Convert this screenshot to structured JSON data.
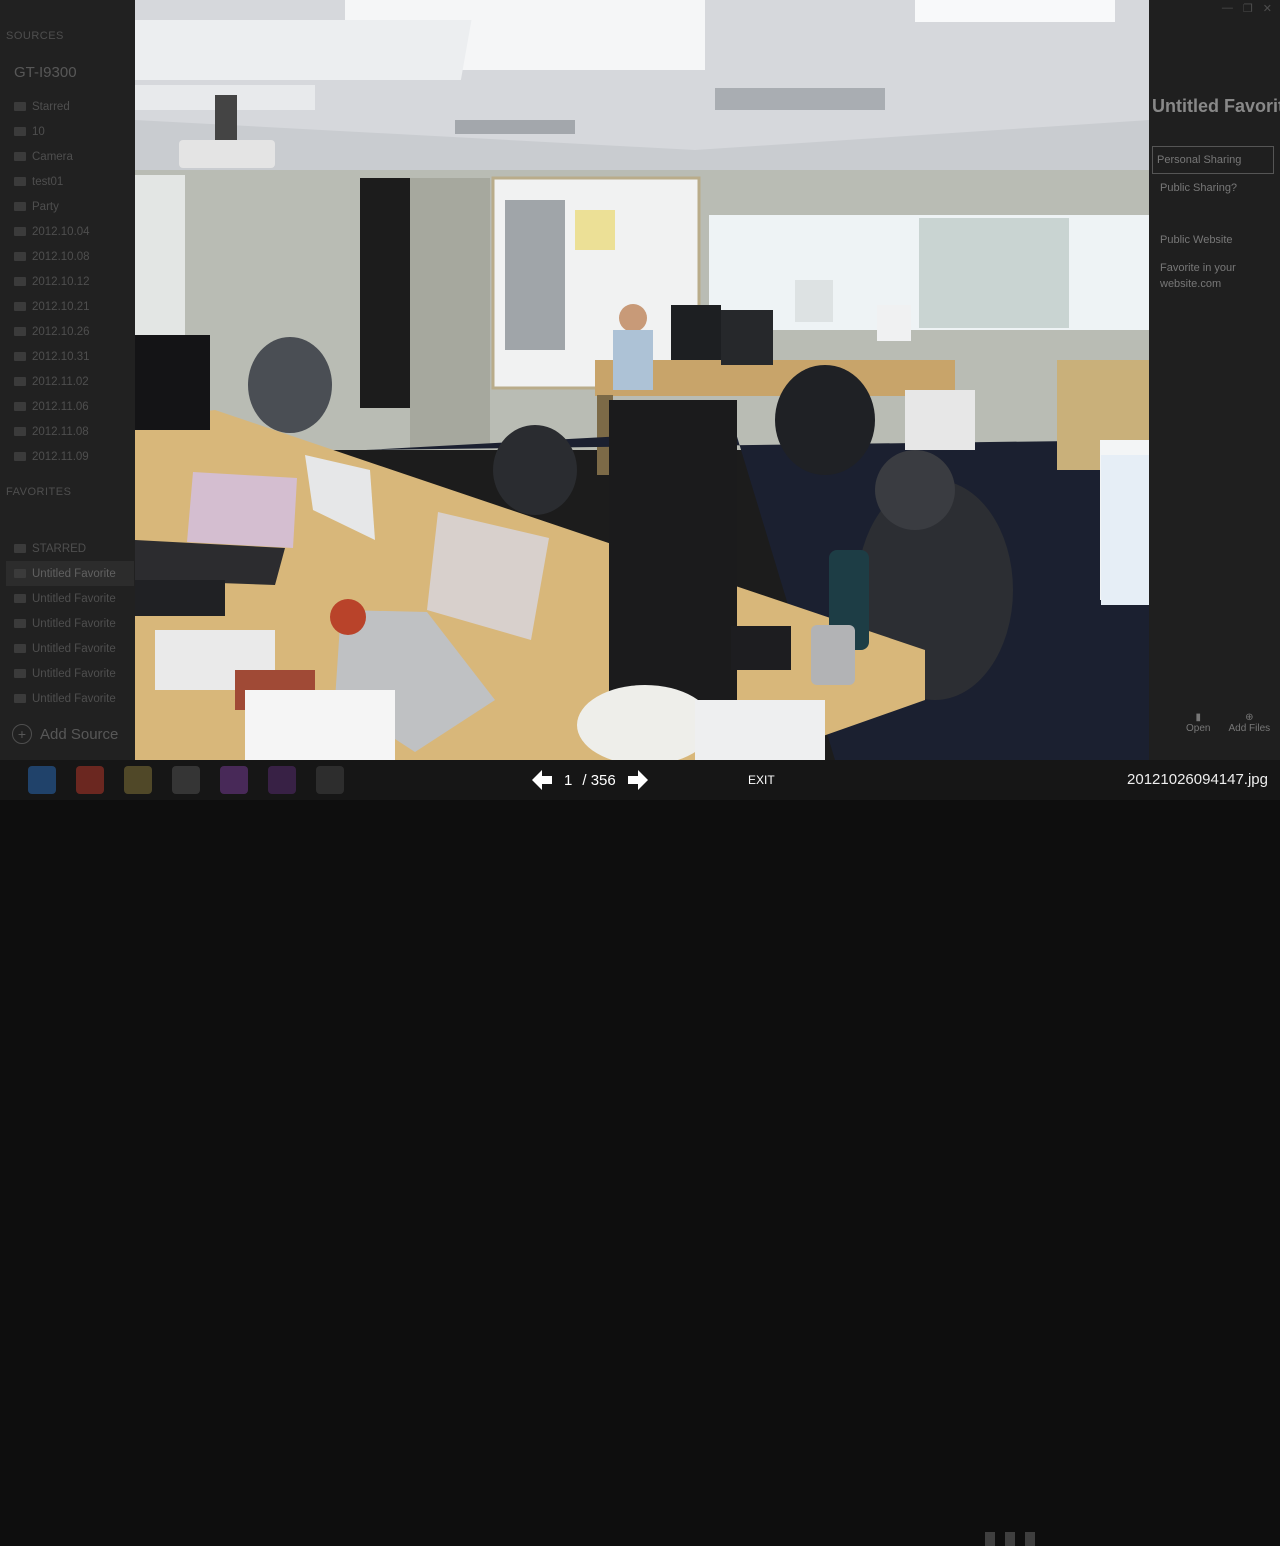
{
  "background_app": {
    "sources_header": "SOURCES",
    "device_name": "GT-I9300",
    "source_items": [
      "Starred",
      "10",
      "Camera",
      "test01",
      "Party",
      "2012.10.04",
      "2012.10.08",
      "2012.10.12",
      "2012.10.21",
      "2012.10.26",
      "2012.10.31",
      "2012.11.02",
      "2012.11.06",
      "2012.11.08",
      "2012.11.09"
    ],
    "favorites_header": "FAVORITES",
    "favorite_items": [
      "STARRED",
      "Untitled Favorite",
      "Untitled Favorite",
      "Untitled Favorite",
      "Untitled Favorite",
      "Untitled Favorite",
      "Untitled Favorite"
    ],
    "add_source_label": "Add Source",
    "right_panel_title": "Untitled Favorite",
    "right_panel_box": "Personal Sharing",
    "right_panel_lines": [
      "Public Sharing?",
      "Public Website",
      "Favorite in your",
      "website.com"
    ],
    "right_panel_buttons": [
      "Open",
      "Add Files"
    ]
  },
  "photo": {
    "description_name": "office-photo"
  },
  "viewer": {
    "current_page": "1",
    "separator": "/",
    "total_pages": "356",
    "exit_label": "EXIT",
    "filename": "20121026094147.jpg"
  },
  "colors": {
    "bar_bg": "#161616",
    "text": "#ffffff"
  }
}
